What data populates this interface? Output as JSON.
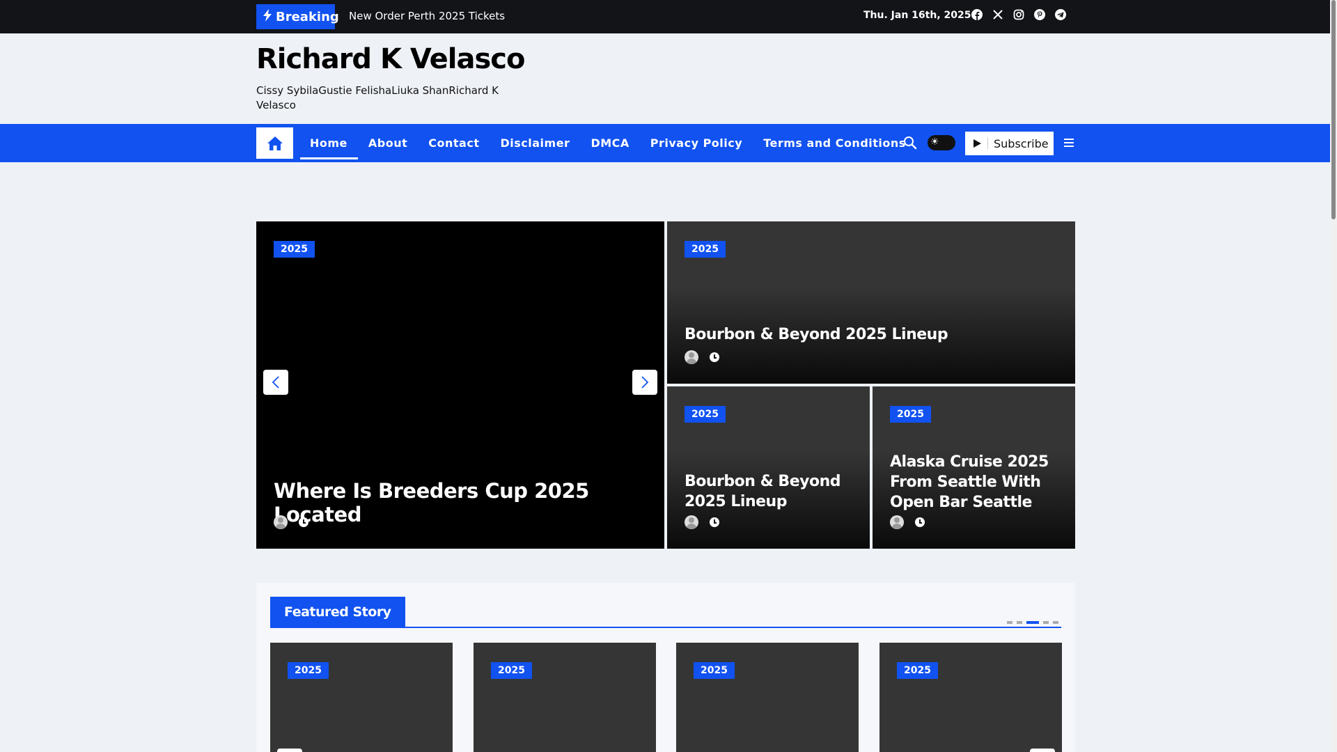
{
  "topbar": {
    "breaking_label": "Breaking",
    "ticker_text": "New Order Perth 2025 Tickets",
    "date": "Thu. Jan 16th, 2025",
    "social_icons": [
      "facebook-icon",
      "x-icon",
      "instagram-icon",
      "pinterest-icon",
      "telegram-icon"
    ]
  },
  "header": {
    "site_title": "Richard K Velasco",
    "tagline": "Cissy SybilaGustie FelishaLiuka ShanRichard K Velasco"
  },
  "nav": {
    "items": [
      "Home",
      "About",
      "Contact",
      "Disclaimer",
      "DMCA",
      "Privacy Policy",
      "Terms and Conditions"
    ],
    "active": "Home",
    "subscribe_label": "Subscribe"
  },
  "slider": {
    "main": {
      "badge": "2025",
      "title": "Where Is Breeders Cup 2025 Located"
    },
    "side": [
      {
        "badge": "2025",
        "title": "Bourbon & Beyond 2025 Lineup"
      },
      {
        "badge": "2025",
        "title": "Bourbon & Beyond 2025 Lineup"
      },
      {
        "badge": "2025",
        "title": "Alaska Cruise 2025 From Seattle With Open Bar Seattle"
      }
    ]
  },
  "featured": {
    "heading": "Featured Story",
    "cards": [
      {
        "badge": "2025"
      },
      {
        "badge": "2025"
      },
      {
        "badge": "2025"
      },
      {
        "badge": "2025"
      }
    ]
  },
  "colors": {
    "accent": "#1152f0",
    "topbar_bg": "#121418",
    "page_bg": "#eef1f6"
  }
}
